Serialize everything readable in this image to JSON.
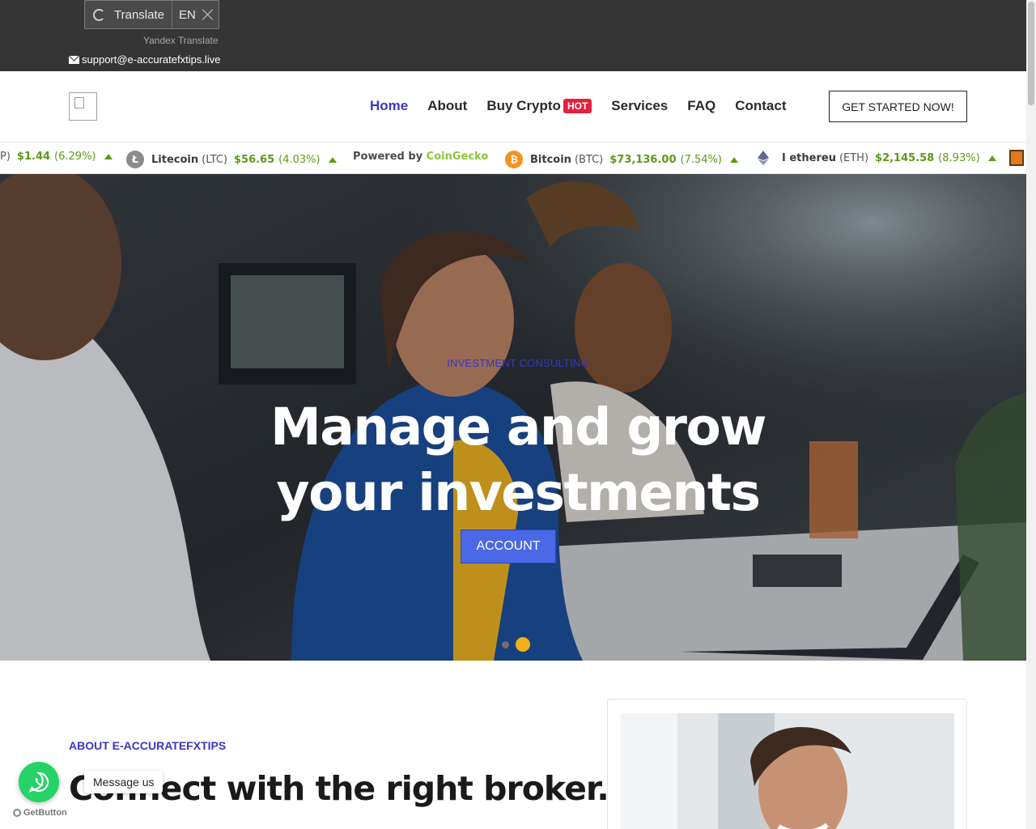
{
  "translate_widget": {
    "label": "Translate",
    "lang": "EN",
    "provider": "Yandex Translate"
  },
  "topbar": {
    "email": "support@e-accuratefxtips.live"
  },
  "nav": {
    "items": [
      {
        "label": "Home",
        "active": true
      },
      {
        "label": "About"
      },
      {
        "label": "Buy Crypto",
        "badge": "HOT"
      },
      {
        "label": "Services"
      },
      {
        "label": "FAQ"
      },
      {
        "label": "Contact"
      }
    ],
    "cta": "GET STARTED NOW!"
  },
  "ticker": {
    "items": [
      {
        "name": "",
        "symbol": "P)",
        "price": "$1.44",
        "change": "(6.29%)"
      },
      {
        "name": "Litecoin",
        "symbol": "(LTC)",
        "price": "$56.65",
        "change": "(4.03%)"
      },
      {
        "powered_prefix": "Powered by",
        "powered_brand": "CoinGecko"
      },
      {
        "name": "Bitcoin",
        "symbol": "(BTC)",
        "price": "$73,136.00",
        "change": "(7.54%)"
      },
      {
        "name": "I ethereu",
        "symbol": "(ETH)",
        "price": "$2,145.58",
        "change": "(8.93%)"
      }
    ],
    "accent_color": "#5b9a16"
  },
  "hero": {
    "kicker": "INVESTMENT CONSULTING",
    "title_line1": "Manage and grow",
    "title_line2": "your investments",
    "button": "ACCOUNT",
    "slides": 2,
    "active_slide": 2
  },
  "about": {
    "kicker": "ABOUT E-ACCURATEFXTIPS",
    "title": "Connect with the right broker."
  },
  "chat_widget": {
    "message": "Message us",
    "brand": "GetButton"
  },
  "colors": {
    "brand": "#3b35c8",
    "hot_badge": "#e2223c",
    "hero_button": "#4b68e6",
    "slider_dot_active": "#f2b118"
  }
}
